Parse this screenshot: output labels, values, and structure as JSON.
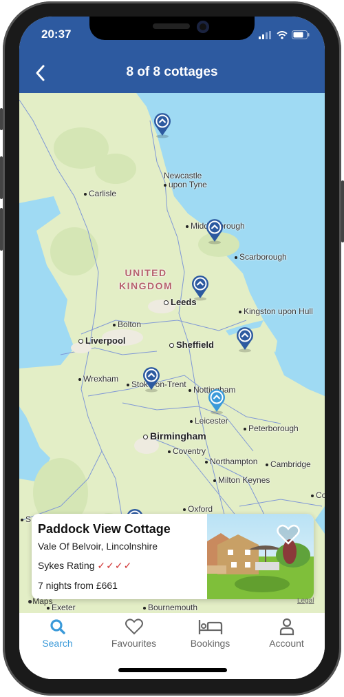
{
  "status_bar": {
    "time": "20:37"
  },
  "header": {
    "title": "8 of 8 cottages",
    "back_icon": "chevron-left-icon"
  },
  "map": {
    "country_label": [
      "UNITED",
      "KINGDOM"
    ],
    "places": [
      {
        "name": "Newcastle",
        "name2": "upon Tyne",
        "type": "dot"
      },
      {
        "name": "Carlisle",
        "type": "dot"
      },
      {
        "name": "Middlesbrough",
        "type": "dot"
      },
      {
        "name": "Scarborough",
        "type": "dot"
      },
      {
        "name": "Leeds",
        "type": "ring"
      },
      {
        "name": "Kingston upon Hull",
        "type": "dot"
      },
      {
        "name": "Bolton",
        "type": "dot"
      },
      {
        "name": "Liverpool",
        "type": "ring"
      },
      {
        "name": "Sheffield",
        "type": "ring"
      },
      {
        "name": "Wrexham",
        "type": "dot"
      },
      {
        "name": "Stoke-on-Trent",
        "type": "dot"
      },
      {
        "name": "Nottingham",
        "type": "dot"
      },
      {
        "name": "Leicester",
        "type": "dot"
      },
      {
        "name": "Peterborough",
        "type": "dot"
      },
      {
        "name": "Birmingham",
        "type": "ring"
      },
      {
        "name": "Coventry",
        "type": "dot"
      },
      {
        "name": "Northampton",
        "type": "dot"
      },
      {
        "name": "Cambridge",
        "type": "dot"
      },
      {
        "name": "Milton Keynes",
        "type": "dot"
      },
      {
        "name": "Oxford",
        "type": "dot"
      },
      {
        "name": "Co",
        "type": "dot"
      },
      {
        "name": "Exeter",
        "type": "dot"
      },
      {
        "name": "Bournemouth",
        "type": "dot"
      },
      {
        "name": "S",
        "type": "dot"
      }
    ],
    "pins_count": 8,
    "selected_pin": 6,
    "pin_color": "#2d5aa0",
    "selected_pin_color": "#3b9ad9",
    "maps_logo": "Maps",
    "legal": "Legal"
  },
  "card": {
    "name": "Paddock View Cottage",
    "location": "Vale Of Belvoir, Lincolnshire",
    "rating_label": "Sykes Rating",
    "rating_checks": "✓✓✓✓",
    "rating_value": 4,
    "price": "7 nights from £661",
    "favourite": false
  },
  "tabs": [
    {
      "label": "Search",
      "icon": "search-icon",
      "active": true
    },
    {
      "label": "Favourites",
      "icon": "heart-icon",
      "active": false
    },
    {
      "label": "Bookings",
      "icon": "bed-icon",
      "active": false
    },
    {
      "label": "Account",
      "icon": "person-icon",
      "active": false
    }
  ]
}
